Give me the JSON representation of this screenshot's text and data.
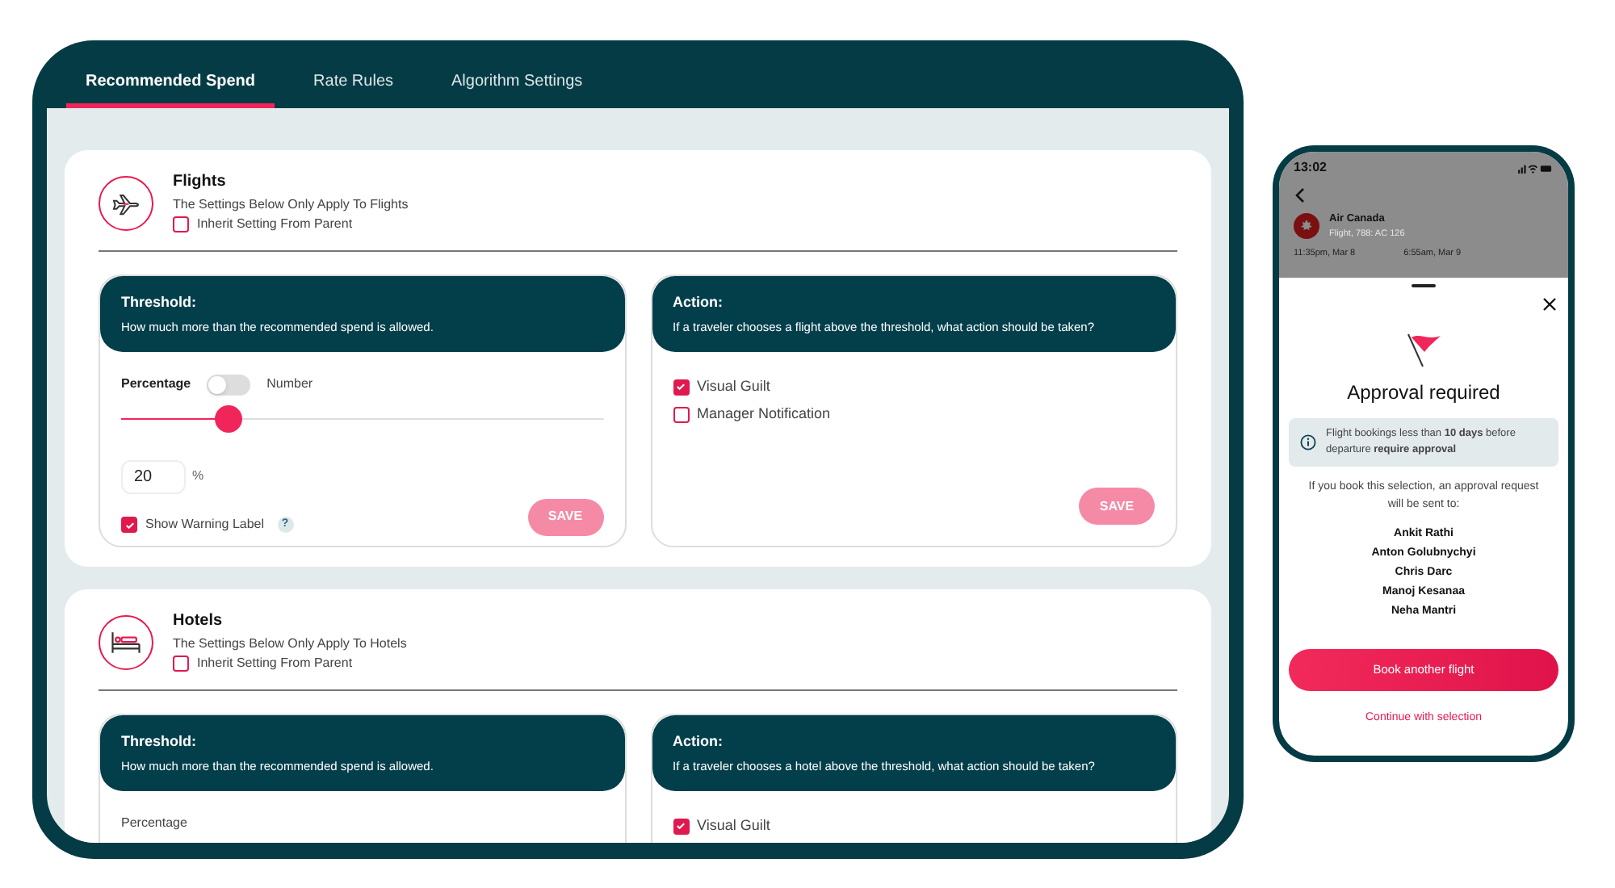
{
  "tabs": [
    {
      "label": "Recommended Spend",
      "selected": true
    },
    {
      "label": "Rate Rules",
      "selected": false
    },
    {
      "label": "Algorithm Settings",
      "selected": false
    }
  ],
  "sections": [
    {
      "kind": "plane",
      "title": "Flights",
      "subtitle": "The Settings Below Only Apply To Flights",
      "inherit": {
        "label": "Inherit Setting From Parent",
        "checked": false
      },
      "threshold": {
        "title": "Threshold:",
        "description": "How much more than the recommended spend is allowed.",
        "mode_label": "Percentage",
        "alt_mode_label": "Number",
        "toggle_on": false,
        "slider": {
          "level": 0.22
        },
        "value": "20",
        "unit": "%",
        "warning": {
          "label": "Show Warning Label",
          "checked": true,
          "help": "?"
        },
        "save": "SAVE"
      },
      "action": {
        "title": "Action:",
        "description": "If a traveler chooses a flight above the threshold, what action should be taken?",
        "options": [
          {
            "label": "Visual Guilt",
            "checked": true
          },
          {
            "label": "Manager Notification",
            "checked": false
          }
        ],
        "save": "SAVE"
      }
    },
    {
      "kind": "bed",
      "title": "Hotels",
      "subtitle": "The Settings Below Only Apply To Hotels",
      "inherit": {
        "label": "Inherit Setting From Parent",
        "checked": false
      },
      "threshold": {
        "title": "Threshold:",
        "description": "How much more than the recommended spend is allowed.",
        "mode_label": "Percentage"
      },
      "action": {
        "title": "Action:",
        "description": "If a traveler chooses a hotel above the threshold, what action should be taken?",
        "options": [
          {
            "label": "Visual Guilt",
            "checked": true
          }
        ]
      }
    }
  ],
  "phone": {
    "time": "13:02",
    "airline": "Air Canada",
    "flight": "Flight, 788: AC 126",
    "departure": "11:35pm, Mar 8",
    "arrival": "6:55am, Mar 9",
    "sheet": {
      "title": "Approval required",
      "info": "Flight bookings less than **10 days** before departure **require approval**",
      "body": "If you book this selection, an approval request will be sent to:",
      "approvers": [
        "Ankit Rathi",
        "Anton Golubnychyi",
        "Chris Darc",
        "Manoj Kesanaa",
        "Neha Mantri"
      ],
      "primary_button": "Book another flight",
      "link": "Continue with selection"
    }
  }
}
